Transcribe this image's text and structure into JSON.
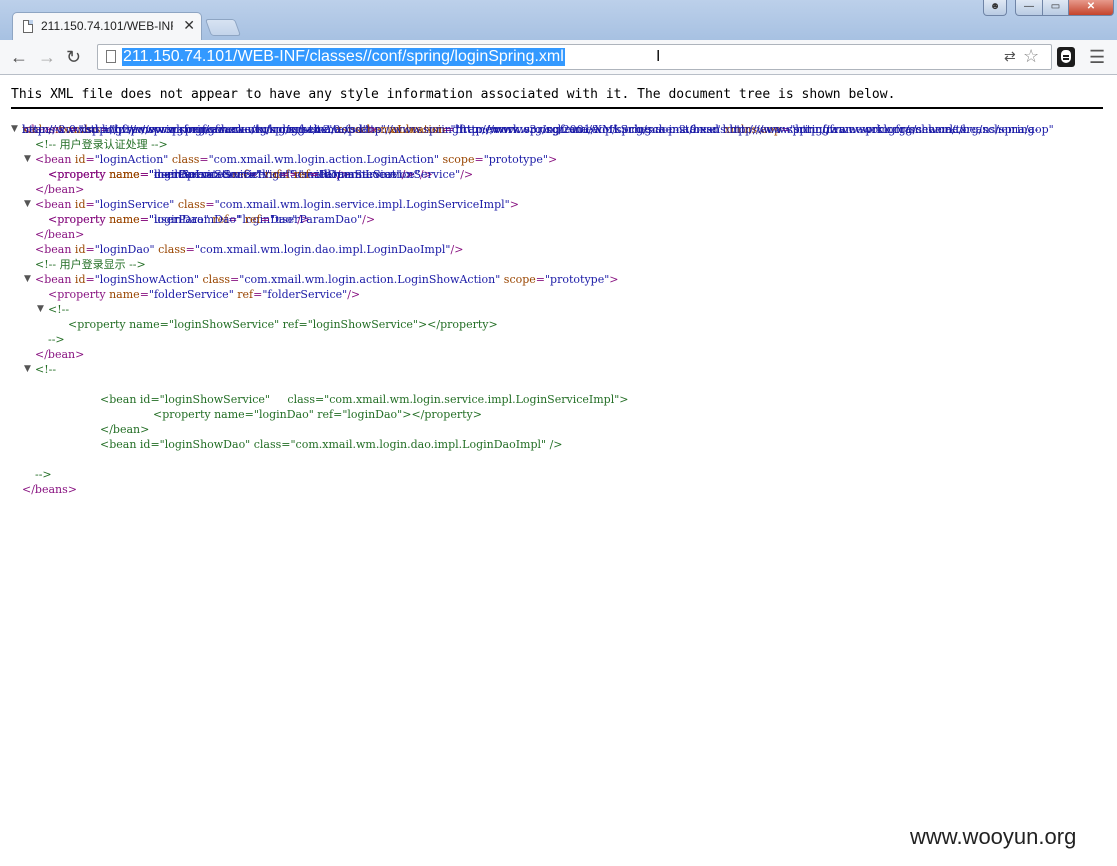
{
  "browser": {
    "tab_title": "211.150.74.101/WEB-INF",
    "url": "211.150.74.101/WEB-INF/classes//conf/spring/loginSpring.xml",
    "icons": {
      "back": "arrow-left-icon",
      "forward": "arrow-right-icon",
      "reload": "reload-icon",
      "bookmark": "star-icon",
      "translate": "translate-icon",
      "extension": "anonymous-mask-icon",
      "menu": "hamburger-menu-icon"
    }
  },
  "viewer": {
    "info": "This XML file does not appear to have any style information associated with it. The document tree is shown below."
  },
  "xml_lines": [
    {
      "kind": "root_open_1",
      "text": "xmlns=\"http://www.springframework.org/schema/beans\""
    },
    {
      "kind": "root_open_2"
    },
    {
      "kind": "root_open_3"
    },
    {
      "kind": "root_open_4"
    },
    {
      "kind": "comment",
      "text": "<!-- 用户登录认证处理 -->"
    },
    {
      "kind": "bean",
      "id": "loginAction",
      "class": "com.xmail.wm.login.action.LoginAction",
      "scope": "prototype"
    },
    {
      "kind": "property",
      "name": "loginService",
      "ref": "loginService"
    },
    {
      "kind": "property",
      "name": "mailOperateService",
      "ref": "mailOperateService"
    },
    {
      "kind": "property",
      "name": "userParamService",
      "ref": "userParamService"
    },
    {
      "kind": "property",
      "name": "domainLocationService",
      "ref": "domainLocationService"
    },
    {
      "kind": "close",
      "text": "</bean>"
    },
    {
      "kind": "bean",
      "id": "loginService",
      "class": "com.xmail.wm.login.service.impl.LoginServiceImpl"
    },
    {
      "kind": "property",
      "name": "loginDao",
      "ref": "loginDao"
    },
    {
      "kind": "property",
      "name": "userParamDao",
      "ref": "userParamDao"
    },
    {
      "kind": "close",
      "text": "</bean>"
    },
    {
      "kind": "bean_self",
      "id": "loginDao",
      "class": "com.xmail.wm.login.dao.impl.LoginDaoImpl"
    },
    {
      "kind": "comment",
      "text": "<!-- 用户登录显示 -->"
    },
    {
      "kind": "bean",
      "id": "loginShowAction",
      "class": "com.xmail.wm.login.action.LoginShowAction",
      "scope": "prototype"
    },
    {
      "kind": "property",
      "name": "folderService",
      "ref": "folderService"
    },
    {
      "kind": "comment",
      "text": "<!--"
    },
    {
      "kind": "comment",
      "text": "<property name=\"loginShowService\" ref=\"loginShowService\"></property>"
    },
    {
      "kind": "comment",
      "text": "-->"
    },
    {
      "kind": "close",
      "text": "</bean>"
    },
    {
      "kind": "comment",
      "text": "<!--"
    },
    {
      "kind": "comment",
      "text": "<bean id=\"loginShowService\"     class=\"com.xmail.wm.login.service.impl.LoginServiceImpl\">"
    },
    {
      "kind": "comment",
      "text": "<property name=\"loginDao\" ref=\"loginDao\"></property>"
    },
    {
      "kind": "comment",
      "text": "</bean>"
    },
    {
      "kind": "comment",
      "text": "<bean id=\"loginShowDao\" class=\"com.xmail.wm.login.dao.impl.LoginDaoImpl\" />"
    },
    {
      "kind": "comment",
      "text": "-->"
    },
    {
      "kind": "close",
      "text": "</beans>"
    }
  ],
  "xml_root": {
    "xsi": "http://www.w3.org/2001/XMLSchema-instance",
    "aop": "http://www.springframework.org/schema/aop",
    "tx": "http://www.springframework.org/schema/tx",
    "schema_1": "http://www.springframework.org/schema/beans http://www.springframework.org/schema/beans/spring-",
    "schema_2": "beans-2.0.xsd http://www.springframework.org/schema/aop http://www.springframework.org/schema/aop/spring-aop-2.0.xsd http://www.springframework.org/schema/tx",
    "schema_3": "http://www.springframework.org/schema/tx/spring-tx-2.0.xsd"
  },
  "watermark": "www.wooyun.org"
}
